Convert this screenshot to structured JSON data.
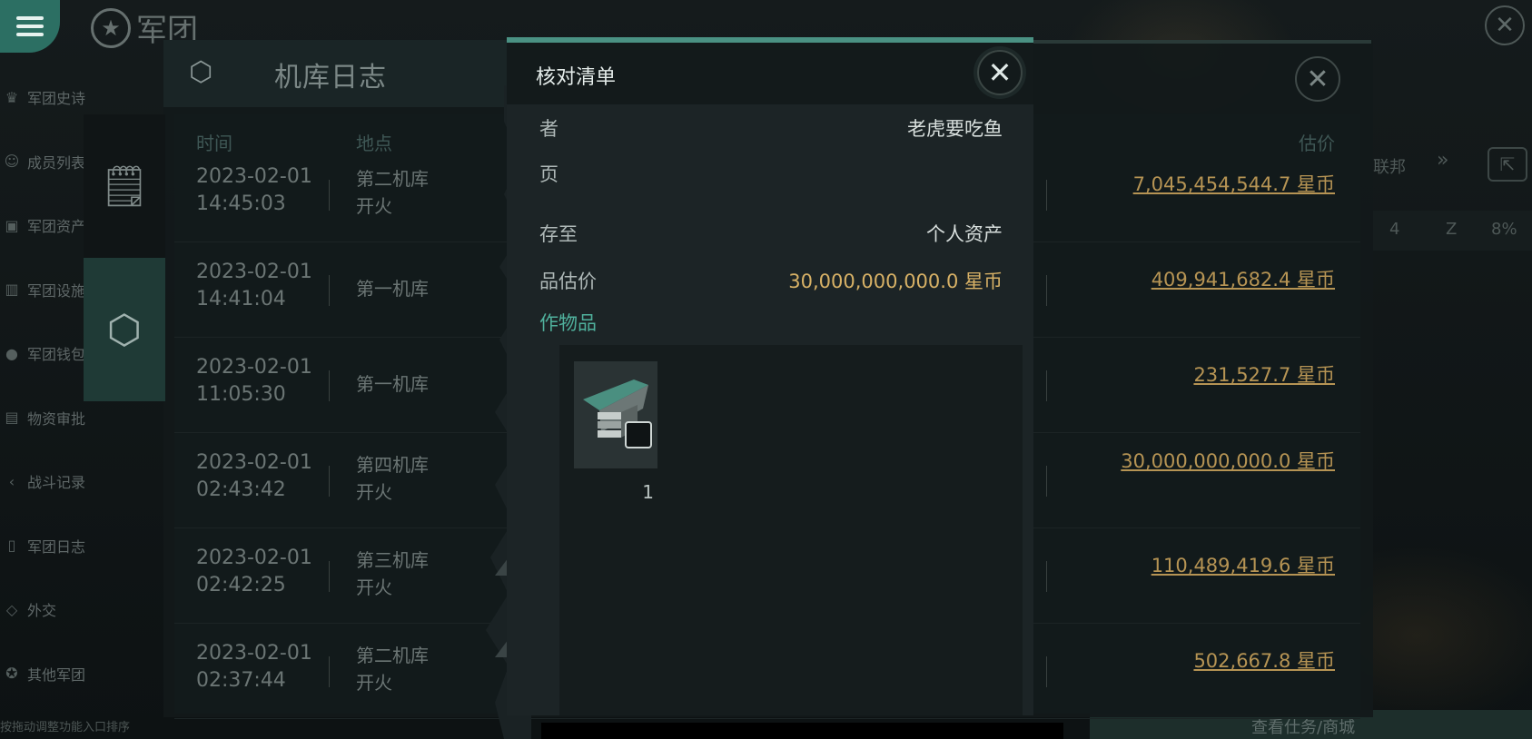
{
  "app": {
    "title": "军团"
  },
  "side_nav": {
    "items": [
      {
        "label": "军团史诗",
        "icon": "crown-icon"
      },
      {
        "label": "成员列表",
        "icon": "person-icon"
      },
      {
        "label": "军团资产",
        "icon": "asset-icon"
      },
      {
        "label": "军团设施",
        "icon": "chart-icon"
      },
      {
        "label": "军团钱包",
        "icon": "wallet-icon"
      },
      {
        "label": "物资审批",
        "icon": "approval-icon"
      },
      {
        "label": "战斗记录",
        "icon": "battle-icon"
      },
      {
        "label": "军团日志",
        "icon": "log-icon"
      },
      {
        "label": "外交",
        "icon": "diplomacy-icon"
      },
      {
        "label": "其他军团",
        "icon": "star-icon"
      }
    ],
    "hint": "按拖动调整功能入口排序"
  },
  "hangar_log": {
    "title": "机库日志",
    "columns": {
      "time": "时间",
      "place": "地点",
      "price": "估价"
    },
    "rows": [
      {
        "time": "2023-02-01\n14:45:03",
        "place": "第二机库\n开火",
        "price": "7,045,454,544.7 星币"
      },
      {
        "time": "2023-02-01\n14:41:04",
        "place": "第一机库",
        "price": "409,941,682.4 星币"
      },
      {
        "time": "2023-02-01\n11:05:30",
        "place": "第一机库",
        "price": "231,527.7 星币"
      },
      {
        "time": "2023-02-01\n02:43:42",
        "place": "第四机库\n开火",
        "price": "30,000,000,000.0 星币"
      },
      {
        "time": "2023-02-01\n02:42:25",
        "place": "第三机库\n开火",
        "price": "110,489,419.6 星币"
      },
      {
        "time": "2023-02-01\n02:37:44",
        "place": "第二机库\n开火",
        "price": "502,667.8 星币"
      }
    ]
  },
  "right_strip": {
    "label": "联邦",
    "arrow": "»",
    "nums": [
      "4",
      "Z",
      "8%"
    ]
  },
  "bottom_right": "查看仕务/商城",
  "dialog": {
    "title": "核对清单",
    "fields": [
      {
        "key": "者",
        "value": "老虎要吃鱼"
      },
      {
        "key": "页",
        "value": ""
      },
      {
        "key": "存至",
        "value": "个人资产"
      },
      {
        "key": "品估价",
        "value": "30,000,000,000.0 星币"
      }
    ],
    "items_label": "作物品",
    "item": {
      "count": "1",
      "icon": "ship-icon"
    }
  },
  "colors": {
    "accent": "#4a9183",
    "gold": "#d7b166",
    "link_gold": "#b69454"
  }
}
